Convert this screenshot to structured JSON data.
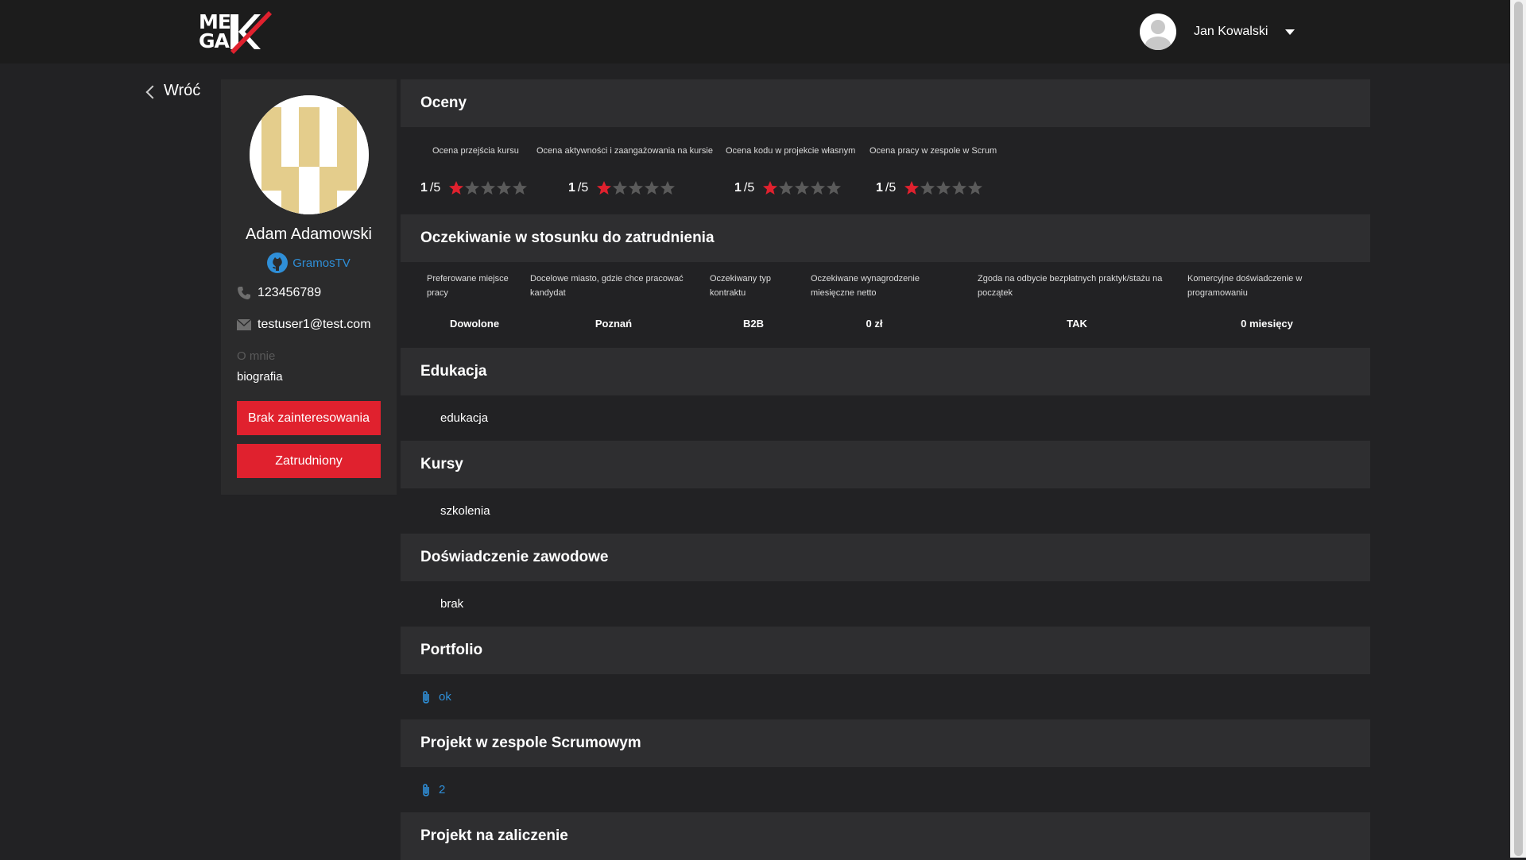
{
  "header": {
    "logo_text_line1": "ME",
    "logo_text_line2": "GA",
    "user_name": "Jan Kowalski"
  },
  "back_label": "Wróć",
  "profile": {
    "name": "Adam Adamowski",
    "github": "GramosTV",
    "phone": "123456789",
    "email": "testuser1@test.com",
    "about_label": "O mnie",
    "about_text": "biografia",
    "btn_no_interest": "Brak zainteresowania",
    "btn_hired": "Zatrudniony"
  },
  "sections": {
    "ratings": {
      "title": "Oceny",
      "items": [
        {
          "label": "Ocena przejścia kursu",
          "value": "1",
          "max": "/5",
          "stars": 1
        },
        {
          "label": "Ocena aktywności i zaangażowania na kursie",
          "value": "1",
          "max": "/5",
          "stars": 1
        },
        {
          "label": "Ocena kodu w projekcie własnym",
          "value": "1",
          "max": "/5",
          "stars": 1
        },
        {
          "label": "Ocena pracy w zespole w Scrum",
          "value": "1",
          "max": "/5",
          "stars": 1
        }
      ]
    },
    "expectations": {
      "title": "Oczekiwanie w stosunku do zatrudnienia",
      "items": [
        {
          "label": "Preferowane miejsce pracy",
          "value": "Dowolone"
        },
        {
          "label": "Docelowe miasto, gdzie chce pracować kandydat",
          "value": "Poznań"
        },
        {
          "label": "Oczekiwany typ kontraktu",
          "value": "B2B"
        },
        {
          "label": "Oczekiwane wynagrodzenie miesięczne netto",
          "value": "0 zł"
        },
        {
          "label": "Zgoda na odbycie bezpłatnych praktyk/stażu na początek",
          "value": "TAK"
        },
        {
          "label": "Komercyjne doświadczenie w programowaniu",
          "value": "0 miesięcy"
        }
      ]
    },
    "education": {
      "title": "Edukacja",
      "text": "edukacja"
    },
    "courses": {
      "title": "Kursy",
      "text": "szkolenia"
    },
    "experience": {
      "title": "Doświadczenie zawodowe",
      "text": "brak"
    },
    "portfolio": {
      "title": "Portfolio",
      "link": "ok"
    },
    "scrum_project": {
      "title": "Projekt w zespole Scrumowym",
      "link": "2"
    },
    "final_project": {
      "title": "Projekt na zaliczenie"
    }
  },
  "colors": {
    "accent_red": "#e0212e",
    "link_blue": "#2f8fd8",
    "star_active": "#e0212e",
    "star_inactive": "#5a5a5a"
  }
}
